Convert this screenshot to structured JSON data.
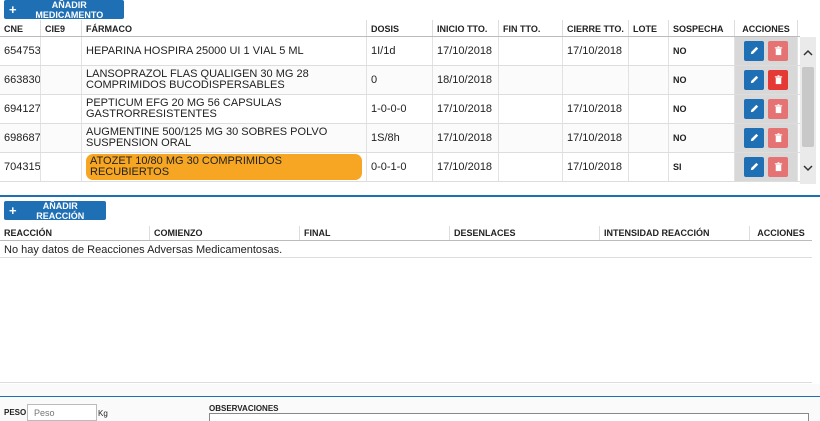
{
  "buttons": {
    "add_med": "AÑADIR MEDICAMENTO",
    "add_reaction": "AÑADIR REACCIÓN"
  },
  "meds_table": {
    "headers": [
      "CNE",
      "CIE9",
      "FÁRMACO",
      "DOSIS",
      "INICIO TTO.",
      "FIN TTO.",
      "CIERRE TTO.",
      "LOTE",
      "SOSPECHA",
      "ACCIONES"
    ],
    "rows": [
      {
        "cne": "654753",
        "cie9": "",
        "farmaco": "HEPARINA HOSPIRA 25000 UI 1 VIAL 5 ML",
        "dosis": "1I/1d",
        "inicio": "17/10/2018",
        "fin": "",
        "cierre": "17/10/2018",
        "lote": "",
        "sospecha": "NO"
      },
      {
        "cne": "663830",
        "cie9": "",
        "farmaco": "LANSOPRAZOL FLAS QUALIGEN 30 MG 28 COMPRIMIDOS BUCODISPERSABLES",
        "dosis": "0",
        "inicio": "18/10/2018",
        "fin": "",
        "cierre": "",
        "lote": "",
        "sospecha": "NO"
      },
      {
        "cne": "694127",
        "cie9": "",
        "farmaco": "PEPTICUM EFG 20 MG 56 CAPSULAS GASTRORRESISTENTES",
        "dosis": "1-0-0-0",
        "inicio": "17/10/2018",
        "fin": "",
        "cierre": "17/10/2018",
        "lote": "",
        "sospecha": "NO"
      },
      {
        "cne": "698687",
        "cie9": "",
        "farmaco": "AUGMENTINE 500/125 MG 30 SOBRES POLVO SUSPENSION ORAL",
        "dosis": "1S/8h",
        "inicio": "17/10/2018",
        "fin": "",
        "cierre": "17/10/2018",
        "lote": "",
        "sospecha": "NO"
      },
      {
        "cne": "704315",
        "cie9": "",
        "farmaco": "ATOZET 10/80 MG 30 COMPRIMIDOS RECUBIERTOS",
        "dosis": "0-0-1-0",
        "inicio": "17/10/2018",
        "fin": "",
        "cierre": "17/10/2018",
        "lote": "",
        "sospecha": "SI"
      }
    ]
  },
  "reactions_table": {
    "headers": [
      "REACCIÓN",
      "COMIENZO",
      "FINAL",
      "DESENLACES",
      "INTENSIDAD REACCIÓN",
      "ACCIONES"
    ],
    "empty_text": "No hay datos de Reacciones Adversas Medicamentosas."
  },
  "footer": {
    "peso_label": "PESO:",
    "peso_placeholder": "Peso",
    "peso_unit": "Kg",
    "obs_label": "OBSERVACIONES"
  },
  "colors": {
    "primary": "#1f6fb5",
    "highlight": "#f6a623",
    "delete": "#e53935"
  }
}
